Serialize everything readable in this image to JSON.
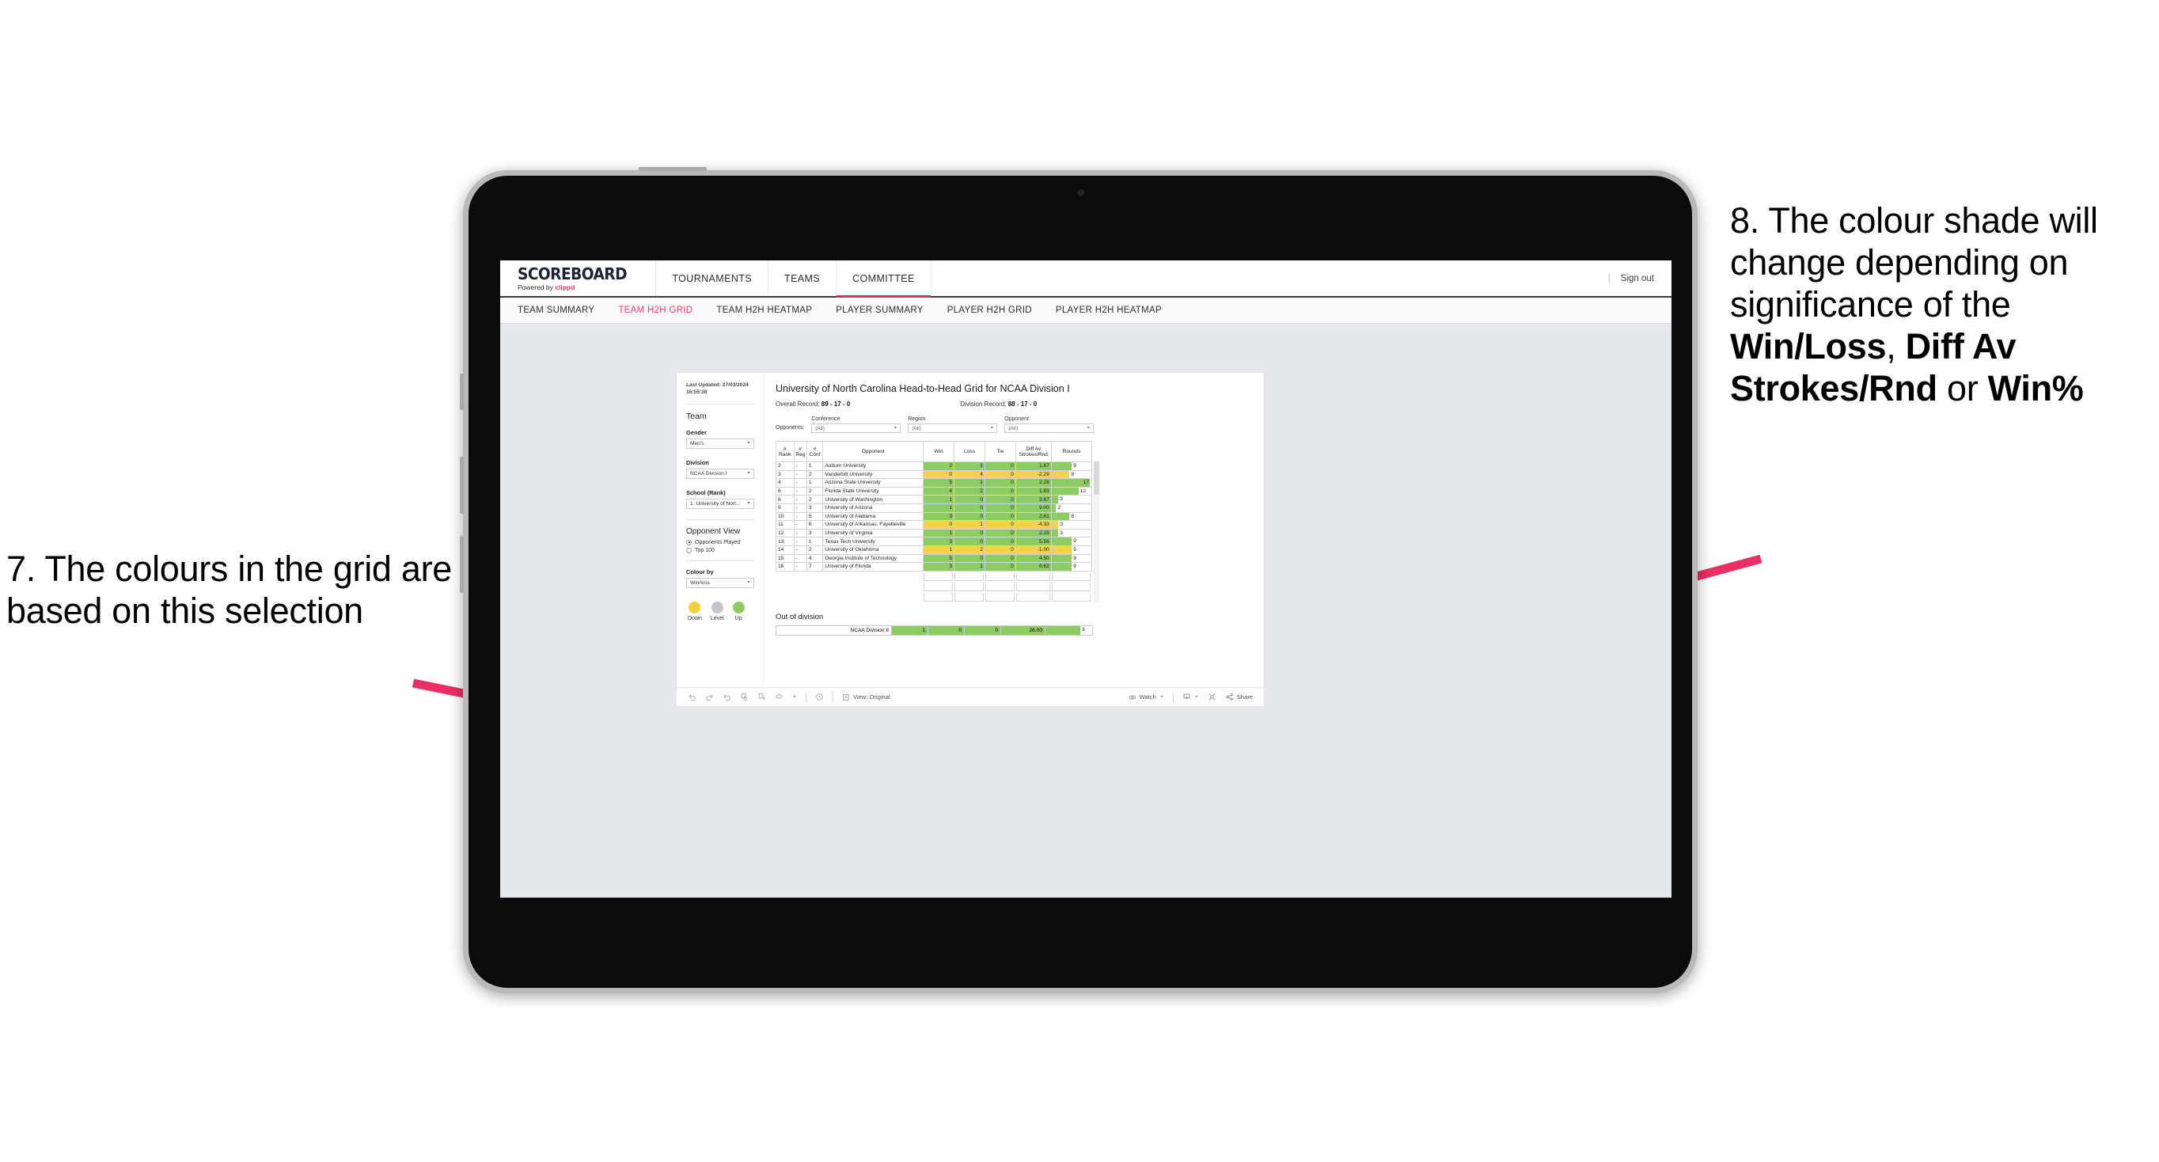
{
  "annotations": {
    "left": "7. The colours in the grid are based on this selection",
    "right_parts": [
      {
        "text": "8. The colour shade will change depending on significance of the ",
        "bold": false
      },
      {
        "text": "Win/Loss",
        "bold": true
      },
      {
        "text": ", ",
        "bold": false
      },
      {
        "text": "Diff Av Strokes/Rnd",
        "bold": true
      },
      {
        "text": " or ",
        "bold": false
      },
      {
        "text": "Win%",
        "bold": true
      }
    ],
    "arrow_color": "#eb2e63"
  },
  "app": {
    "brand": {
      "title": "SCOREBOARD",
      "powered_prefix": "Powered by ",
      "powered_brand": "clippd"
    },
    "top_nav": [
      {
        "label": "TOURNAMENTS",
        "active": false
      },
      {
        "label": "TEAMS",
        "active": false
      },
      {
        "label": "COMMITTEE",
        "active": true
      }
    ],
    "sign_out": "Sign out",
    "sub_nav": [
      {
        "label": "TEAM SUMMARY",
        "active": false
      },
      {
        "label": "TEAM H2H GRID",
        "active": true
      },
      {
        "label": "TEAM H2H HEATMAP",
        "active": false
      },
      {
        "label": "PLAYER SUMMARY",
        "active": false
      },
      {
        "label": "PLAYER H2H GRID",
        "active": false
      },
      {
        "label": "PLAYER H2H HEATMAP",
        "active": false
      }
    ]
  },
  "sidebar": {
    "last_updated": "Last Updated: 27/03/2024 16:55:38",
    "team_heading": "Team",
    "gender_label": "Gender",
    "gender_value": "Men's",
    "division_label": "Division",
    "division_value": "NCAA Division I",
    "school_label": "School (Rank)",
    "school_value": "1. University of Nort...",
    "opponent_view_heading": "Opponent View",
    "opponent_view_options": [
      {
        "label": "Opponents Played",
        "selected": true
      },
      {
        "label": "Top 100",
        "selected": false
      }
    ],
    "colour_by_label": "Colour by",
    "colour_by_value": "Win/loss",
    "legend": [
      {
        "label": "Down",
        "color": "#f2d13f"
      },
      {
        "label": "Level",
        "color": "#c4c6cb"
      },
      {
        "label": "Up",
        "color": "#8ccc63"
      }
    ]
  },
  "viz": {
    "title": "University of North Carolina Head-to-Head Grid for NCAA Division I",
    "overall_record_label": "Overall Record: ",
    "overall_record_value": "89 - 17 - 0",
    "division_record_label": "Division Record: ",
    "division_record_value": "88 - 17 - 0",
    "opponents_label": "Opponents:",
    "filters": [
      {
        "label": "Conference",
        "value": "(All)"
      },
      {
        "label": "Region",
        "value": "(All)"
      },
      {
        "label": "Opponent",
        "value": "(All)"
      }
    ],
    "out_of_division_title": "Out of division"
  },
  "chart_data": {
    "type": "table",
    "title": "University of North Carolina Head-to-Head Grid for NCAA Division I",
    "columns": [
      "# Rank",
      "# Reg",
      "# Conf",
      "Opponent",
      "Win",
      "Loss",
      "Tie",
      "Diff Av Strokes/Rnd",
      "Rounds"
    ],
    "colour_encoding": "Win/loss — green (Up) when wins exceed losses, yellow (Down) when losses exceed wins",
    "rounds_axis_max": 17,
    "rows": [
      {
        "rank": "2",
        "reg": "-",
        "conf": "1",
        "opponent": "Auburn University",
        "win": "2",
        "loss": "1",
        "tie": "0",
        "diff": "1.67",
        "rounds": 9,
        "state": "win"
      },
      {
        "rank": "3",
        "reg": "-",
        "conf": "2",
        "opponent": "Vanderbilt University",
        "win": "0",
        "loss": "4",
        "tie": "0",
        "diff": "-2.29",
        "rounds": 8,
        "state": "loss"
      },
      {
        "rank": "4",
        "reg": "-",
        "conf": "1",
        "opponent": "Arizona State University",
        "win": "5",
        "loss": "1",
        "tie": "0",
        "diff": "2.28",
        "rounds": 17,
        "state": "win"
      },
      {
        "rank": "6",
        "reg": "-",
        "conf": "2",
        "opponent": "Florida State University",
        "win": "4",
        "loss": "2",
        "tie": "0",
        "diff": "1.83",
        "rounds": 12,
        "state": "win"
      },
      {
        "rank": "8",
        "reg": "-",
        "conf": "2",
        "opponent": "University of Washington",
        "win": "1",
        "loss": "0",
        "tie": "0",
        "diff": "3.67",
        "rounds": 3,
        "state": "win"
      },
      {
        "rank": "9",
        "reg": "-",
        "conf": "3",
        "opponent": "University of Arizona",
        "win": "1",
        "loss": "0",
        "tie": "0",
        "diff": "9.00",
        "rounds": 2,
        "state": "win"
      },
      {
        "rank": "10",
        "reg": "-",
        "conf": "5",
        "opponent": "University of Alabama",
        "win": "3",
        "loss": "0",
        "tie": "0",
        "diff": "2.61",
        "rounds": 8,
        "state": "win"
      },
      {
        "rank": "11",
        "reg": "-",
        "conf": "6",
        "opponent": "University of Arkansas, Fayetteville",
        "win": "0",
        "loss": "1",
        "tie": "0",
        "diff": "-4.33",
        "rounds": 3,
        "state": "loss"
      },
      {
        "rank": "12",
        "reg": "-",
        "conf": "3",
        "opponent": "University of Virginia",
        "win": "1",
        "loss": "0",
        "tie": "0",
        "diff": "2.33",
        "rounds": 3,
        "state": "win"
      },
      {
        "rank": "13",
        "reg": "-",
        "conf": "1",
        "opponent": "Texas Tech University",
        "win": "3",
        "loss": "0",
        "tie": "0",
        "diff": "5.56",
        "rounds": 9,
        "state": "win"
      },
      {
        "rank": "14",
        "reg": "-",
        "conf": "2",
        "opponent": "University of Oklahoma",
        "win": "1",
        "loss": "2",
        "tie": "0",
        "diff": "-1.00",
        "rounds": 9,
        "state": "loss"
      },
      {
        "rank": "15",
        "reg": "-",
        "conf": "4",
        "opponent": "Georgia Institute of Technology",
        "win": "5",
        "loss": "0",
        "tie": "0",
        "diff": "4.50",
        "rounds": 9,
        "state": "win"
      },
      {
        "rank": "16",
        "reg": "-",
        "conf": "7",
        "opponent": "University of Florida",
        "win": "3",
        "loss": "1",
        "tie": "0",
        "diff": "6.62",
        "rounds": 9,
        "state": "win"
      }
    ],
    "out_of_division": [
      {
        "label": "NCAA Division II",
        "win": "1",
        "loss": "0",
        "tie": "0",
        "diff": "26.00",
        "rounds": 3,
        "state": "win"
      }
    ]
  },
  "toolbar": {
    "view_label": "View: Original",
    "watch_label": "Watch",
    "share_label": "Share",
    "icons": [
      "undo-icon",
      "redo-icon",
      "revert-icon",
      "refresh-icon",
      "pause-icon",
      "alerts-icon",
      "clock-icon"
    ]
  }
}
